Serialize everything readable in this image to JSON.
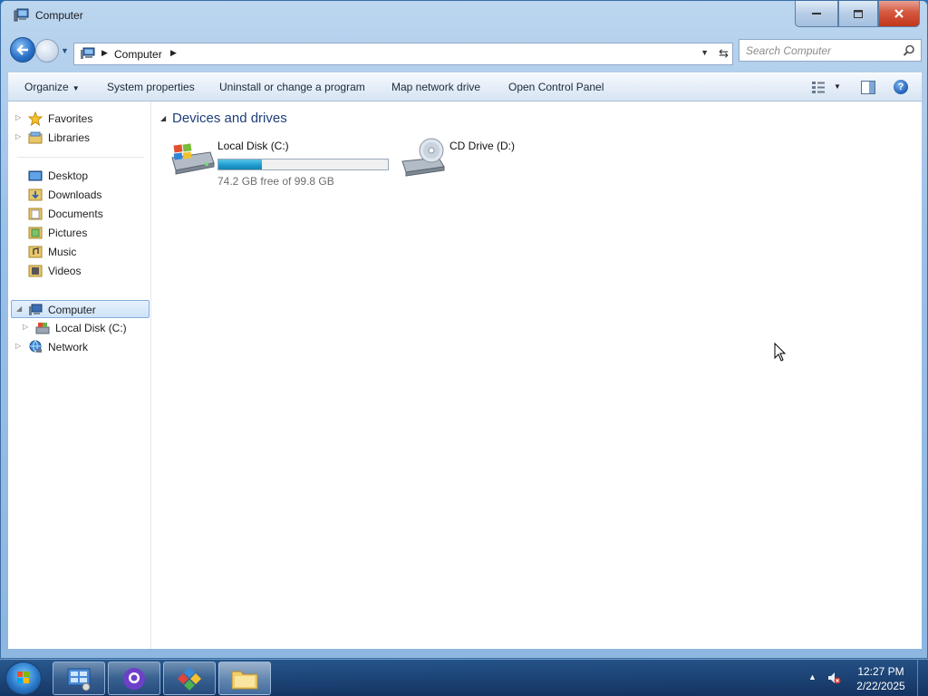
{
  "window": {
    "title": "Computer",
    "icon": "computer-icon",
    "buttons": {
      "minimize": "minimize-icon",
      "maximize": "maximize-icon",
      "close": "close-icon"
    }
  },
  "nav": {
    "address_path": "Computer",
    "search_placeholder": "Search Computer"
  },
  "toolbar": {
    "organize": "Organize",
    "system_properties": "System properties",
    "uninstall": "Uninstall or change a program",
    "map_drive": "Map network drive",
    "control_panel": "Open Control Panel"
  },
  "sidebar": {
    "favorites": "Favorites",
    "libraries": "Libraries",
    "desktop": "Desktop",
    "downloads": "Downloads",
    "documents": "Documents",
    "pictures": "Pictures",
    "music": "Music",
    "videos": "Videos",
    "computer": "Computer",
    "local_disk": "Local Disk (C:)",
    "network": "Network"
  },
  "main": {
    "group_title": "Devices and drives",
    "drives": [
      {
        "name": "Local Disk (C:)",
        "free_text": "74.2 GB free of 99.8 GB",
        "used_fraction": 0.257
      },
      {
        "name": "CD Drive (D:)"
      }
    ]
  },
  "taskbar": {
    "time": "12:27 PM",
    "date": "2/22/2025"
  },
  "colors": {
    "accent": "#1e3f7a",
    "drive_bar": "#1f9fd1",
    "selection": "#cfe4fa"
  }
}
